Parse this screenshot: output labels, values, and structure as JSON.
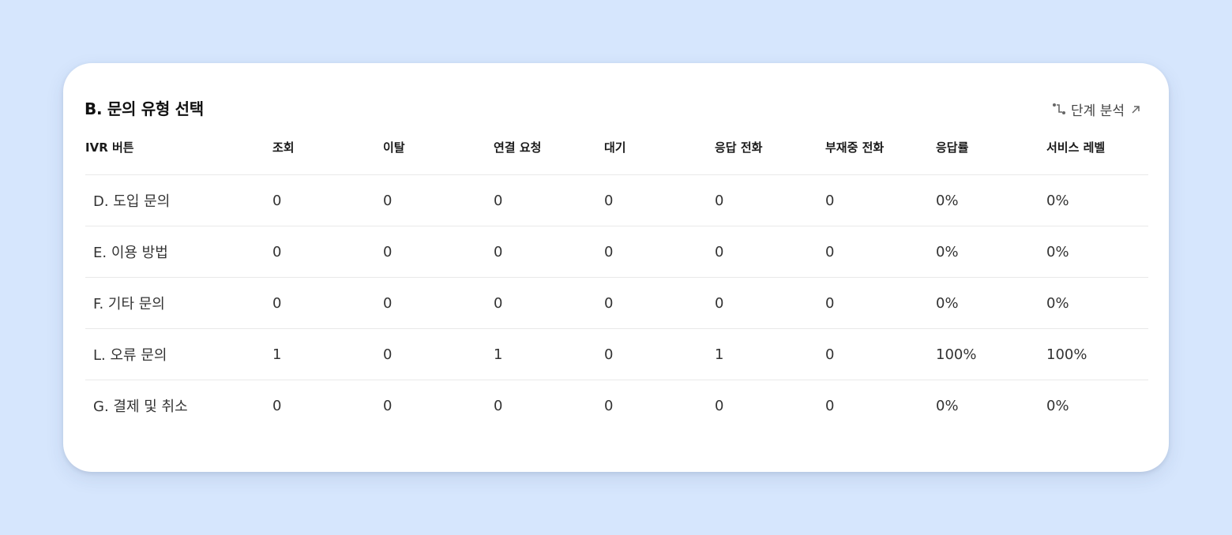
{
  "card": {
    "title": "B. 문의 유형 선택",
    "step_link": {
      "label": "단계 분석",
      "icon": "step-branch-icon",
      "arrow_icon": "external-arrow-icon"
    }
  },
  "table": {
    "columns": [
      "IVR 버튼",
      "조회",
      "이탈",
      "연결 요청",
      "대기",
      "응답 전화",
      "부재중 전화",
      "응답률",
      "서비스 레벨"
    ],
    "rows": [
      [
        "D. 도입 문의",
        "0",
        "0",
        "0",
        "0",
        "0",
        "0",
        "0%",
        "0%"
      ],
      [
        "E. 이용 방법",
        "0",
        "0",
        "0",
        "0",
        "0",
        "0",
        "0%",
        "0%"
      ],
      [
        "F. 기타 문의",
        "0",
        "0",
        "0",
        "0",
        "0",
        "0",
        "0%",
        "0%"
      ],
      [
        "L. 오류 문의",
        "1",
        "0",
        "1",
        "0",
        "1",
        "0",
        "100%",
        "100%"
      ],
      [
        "G. 결제 및 취소",
        "0",
        "0",
        "0",
        "0",
        "0",
        "0",
        "0%",
        "0%"
      ]
    ]
  },
  "colors": {
    "background": "#d6e6fd",
    "card": "#ffffff",
    "divider": "#e9e9e9"
  }
}
